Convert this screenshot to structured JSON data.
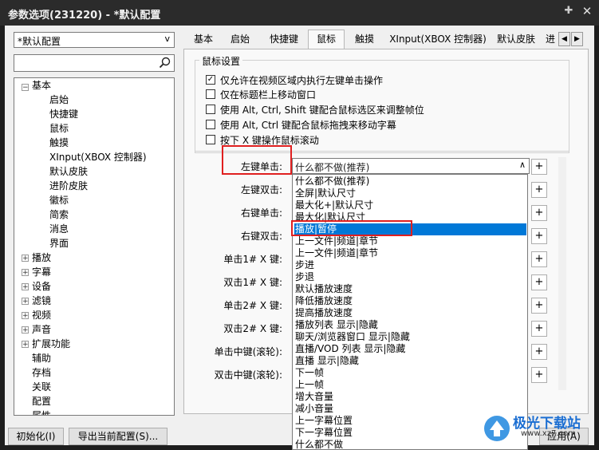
{
  "window": {
    "title": "参数选项(231220) - *默认配置"
  },
  "left": {
    "preset": "*默认配置",
    "search_placeholder": "",
    "tree": [
      {
        "label": "基本",
        "expanded": true
      },
      {
        "label": "启始"
      },
      {
        "label": "快捷键"
      },
      {
        "label": "鼠标"
      },
      {
        "label": "触摸"
      },
      {
        "label": "XInput(XBOX 控制器)"
      },
      {
        "label": "默认皮肤"
      },
      {
        "label": "进阶皮肤"
      },
      {
        "label": "徽标"
      },
      {
        "label": "简索"
      },
      {
        "label": "消息"
      },
      {
        "label": "界面"
      },
      {
        "label": "播放"
      },
      {
        "label": "字幕"
      },
      {
        "label": "设备"
      },
      {
        "label": "滤镜"
      },
      {
        "label": "视频"
      },
      {
        "label": "声音"
      },
      {
        "label": "扩展功能"
      },
      {
        "label": "辅助"
      },
      {
        "label": "存档"
      },
      {
        "label": "关联"
      },
      {
        "label": "配置"
      },
      {
        "label": "属性"
      }
    ]
  },
  "buttons": {
    "init": "初始化(I)",
    "export": "导出当前配置(S)...",
    "apply": "应用(A)"
  },
  "tabs": [
    "基本",
    "启始",
    "快捷键",
    "鼠标",
    "触摸",
    "XInput(XBOX 控制器)",
    "默认皮肤",
    "进"
  ],
  "group": {
    "title": "鼠标设置",
    "checkboxes": [
      {
        "label": "仅允许在视频区域内执行左键单击操作",
        "checked": true
      },
      {
        "label": "仅在标题栏上移动窗口",
        "checked": false
      },
      {
        "label": "使用 Alt, Ctrl, Shift 键配合鼠标选区来调整帧位",
        "checked": false
      },
      {
        "label": "使用 Alt, Ctrl 键配合鼠标拖拽来移动字幕",
        "checked": false
      },
      {
        "label": "按下 X 键操作鼠标滚动",
        "checked": false
      }
    ]
  },
  "actions": [
    {
      "label": "左键单击:",
      "value": "什么都不做(推荐)"
    },
    {
      "label": "左键双击:",
      "value": ""
    },
    {
      "label": "右键单击:",
      "value": ""
    },
    {
      "label": "右键双击:",
      "value": ""
    },
    {
      "label": "单击1# X 键:",
      "value": ""
    },
    {
      "label": "双击1# X 键:",
      "value": ""
    },
    {
      "label": "单击2# X 键:",
      "value": ""
    },
    {
      "label": "双击2# X 键:",
      "value": ""
    },
    {
      "label": "单击中键(滚轮):",
      "value": ""
    },
    {
      "label": "双击中键(滚轮):",
      "value": ""
    }
  ],
  "dropdown": {
    "selected_index": 4,
    "options": [
      "什么都不做(推荐)",
      "全屏|默认尺寸",
      "最大化+|默认尺寸",
      "最大化|默认尺寸",
      "播放|暂停",
      "上一文件|频道|章节",
      "上一文件|频道|章节",
      "步进",
      "步退",
      "默认播放速度",
      "降低播放速度",
      "提高播放速度",
      "播放列表 显示|隐藏",
      "聊天/浏览器窗口 显示|隐藏",
      "直播/VOD 列表 显示|隐藏",
      "直播 显示|隐藏",
      "下一帧",
      "上一帧",
      "增大音量",
      "减小音量",
      "上一字幕位置",
      "下一字幕位置",
      "什么都不做"
    ]
  },
  "plus_label": "+",
  "watermark": {
    "text": "极光下载站",
    "url": "www.xz7.com"
  },
  "colors": {
    "accent": "#0078d7",
    "highlight_box": "#e02020",
    "titlebar": "#2b2b2b"
  }
}
